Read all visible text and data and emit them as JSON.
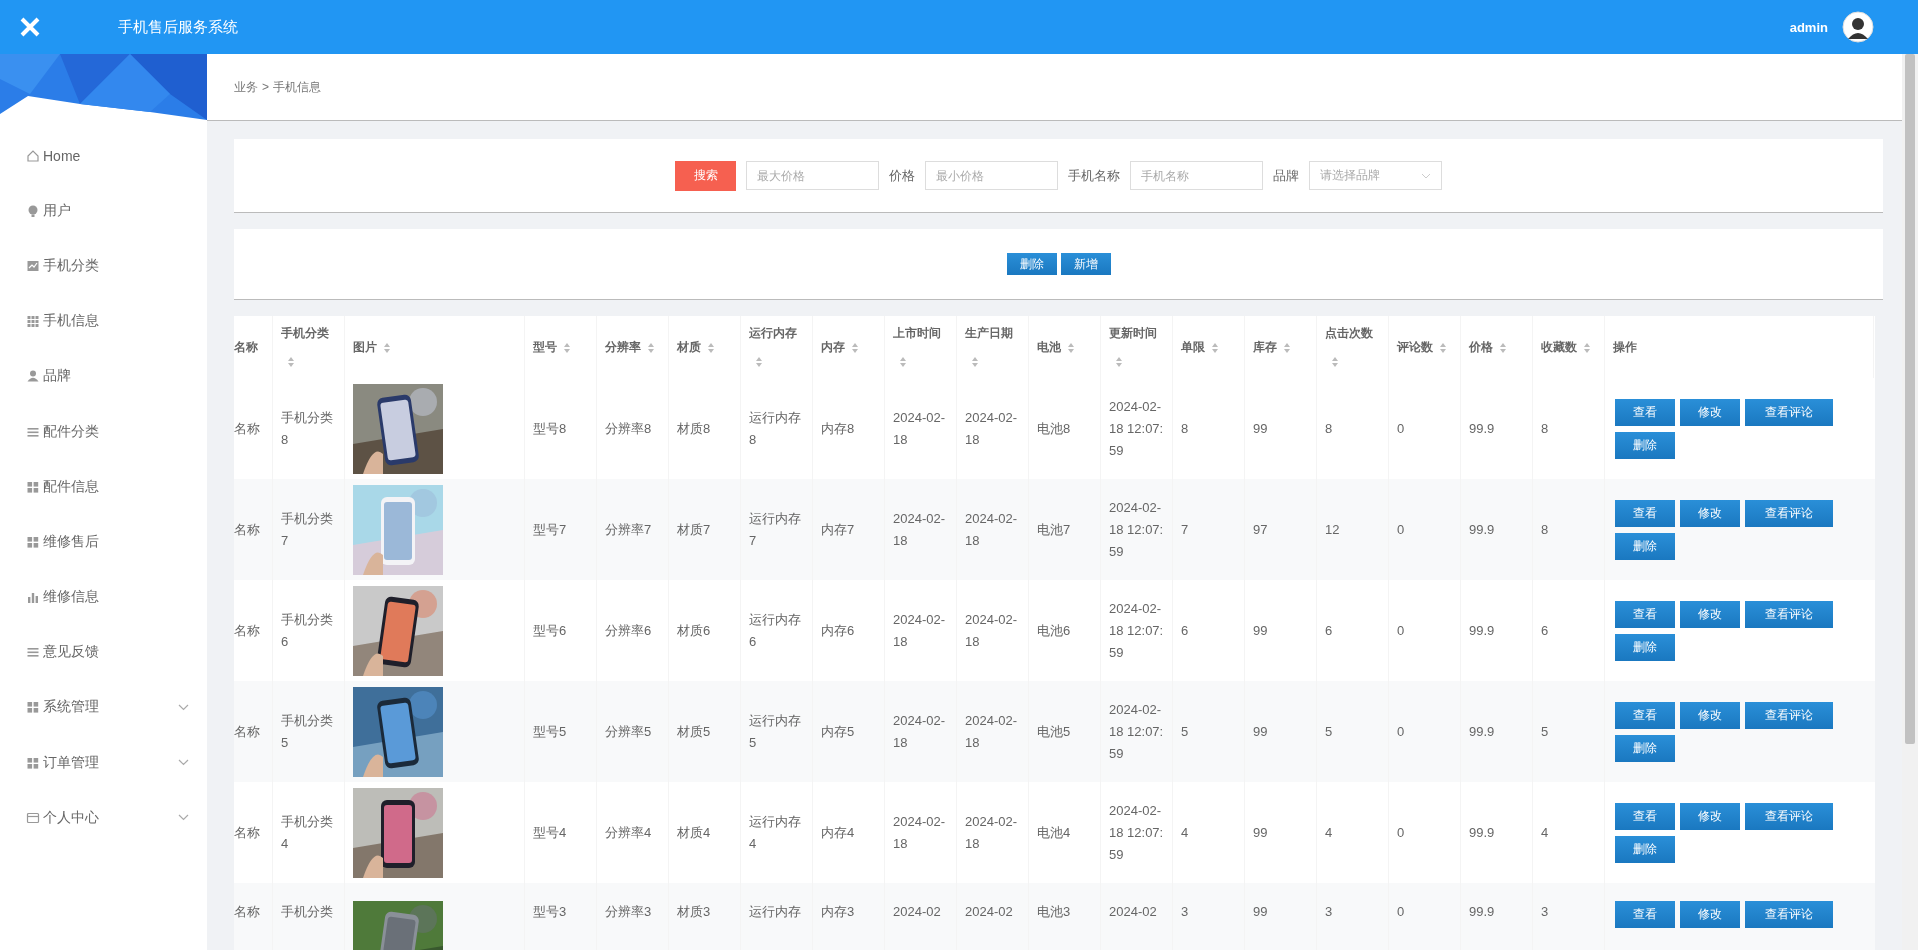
{
  "header": {
    "title": "手机售后服务系统",
    "user": "admin"
  },
  "sidebar": {
    "items": [
      {
        "label": "Home",
        "kind": "link"
      },
      {
        "label": "用户",
        "kind": "link"
      },
      {
        "label": "手机分类",
        "kind": "link"
      },
      {
        "label": "手机信息",
        "kind": "link"
      },
      {
        "label": "品牌",
        "kind": "link"
      },
      {
        "label": "配件分类",
        "kind": "link"
      },
      {
        "label": "配件信息",
        "kind": "link"
      },
      {
        "label": "维修售后",
        "kind": "link"
      },
      {
        "label": "维修信息",
        "kind": "link"
      },
      {
        "label": "意见反馈",
        "kind": "link"
      },
      {
        "label": "系统管理",
        "kind": "group"
      },
      {
        "label": "订单管理",
        "kind": "group"
      },
      {
        "label": "个人中心",
        "kind": "group"
      }
    ]
  },
  "breadcrumb": {
    "items": [
      "业务",
      "手机信息"
    ],
    "separator": ">"
  },
  "search": {
    "button": "搜索",
    "fields": [
      {
        "kind": "input",
        "placeholder": "最大价格"
      },
      {
        "kind": "input",
        "label": "价格",
        "placeholder": "最小价格"
      },
      {
        "kind": "input",
        "label": "手机名称",
        "placeholder": "手机名称"
      },
      {
        "kind": "select",
        "label": "品牌",
        "placeholder": "请选择品牌"
      }
    ]
  },
  "toolbar": {
    "buttons": [
      "删除",
      "新增"
    ]
  },
  "table": {
    "columns": [
      {
        "label": "名称",
        "sortable": false
      },
      {
        "label": "手机分类",
        "sortable": true
      },
      {
        "label": "图片",
        "sortable": true
      },
      {
        "label": "型号",
        "sortable": true
      },
      {
        "label": "分辨率",
        "sortable": true
      },
      {
        "label": "材质",
        "sortable": true
      },
      {
        "label": "运行内存",
        "sortable": true
      },
      {
        "label": "内存",
        "sortable": true
      },
      {
        "label": "上市时间",
        "sortable": true
      },
      {
        "label": "生产日期",
        "sortable": true
      },
      {
        "label": "电池",
        "sortable": true
      },
      {
        "label": "更新时间",
        "sortable": true
      },
      {
        "label": "单限",
        "sortable": true
      },
      {
        "label": "库存",
        "sortable": true
      },
      {
        "label": "点击次数",
        "sortable": true
      },
      {
        "label": "评论数",
        "sortable": true
      },
      {
        "label": "价格",
        "sortable": true
      },
      {
        "label": "收藏数",
        "sortable": true
      },
      {
        "label": "操作",
        "sortable": false
      }
    ],
    "rows": [
      {
        "cells": [
          "名称",
          "手机分类8",
          {
            "kind": "picture"
          },
          "型号8",
          "分辨率8",
          "材质8",
          "运行内存8",
          "内存8",
          "2024-02-18",
          "2024-02-18",
          "电池8",
          "2024-02-18 12:07:59",
          "8",
          "99",
          "8",
          "0",
          "99.9",
          "8"
        ],
        "actions": [
          "查看",
          "修改",
          "查看评论",
          "删除"
        ]
      },
      {
        "cells": [
          "名称",
          "手机分类7",
          {
            "kind": "picture"
          },
          "型号7",
          "分辨率7",
          "材质7",
          "运行内存7",
          "内存7",
          "2024-02-18",
          "2024-02-18",
          "电池7",
          "2024-02-18 12:07:59",
          "7",
          "97",
          "12",
          "0",
          "99.9",
          "8"
        ],
        "actions": [
          "查看",
          "修改",
          "查看评论",
          "删除"
        ]
      },
      {
        "cells": [
          "名称",
          "手机分类6",
          {
            "kind": "picture"
          },
          "型号6",
          "分辨率6",
          "材质6",
          "运行内存6",
          "内存6",
          "2024-02-18",
          "2024-02-18",
          "电池6",
          "2024-02-18 12:07:59",
          "6",
          "99",
          "6",
          "0",
          "99.9",
          "6"
        ],
        "actions": [
          "查看",
          "修改",
          "查看评论",
          "删除"
        ]
      },
      {
        "cells": [
          "名称",
          "手机分类5",
          {
            "kind": "picture"
          },
          "型号5",
          "分辨率5",
          "材质5",
          "运行内存5",
          "内存5",
          "2024-02-18",
          "2024-02-18",
          "电池5",
          "2024-02-18 12:07:59",
          "5",
          "99",
          "5",
          "0",
          "99.9",
          "5"
        ],
        "actions": [
          "查看",
          "修改",
          "查看评论",
          "删除"
        ]
      },
      {
        "cells": [
          "名称",
          "手机分类4",
          {
            "kind": "picture"
          },
          "型号4",
          "分辨率4",
          "材质4",
          "运行内存4",
          "内存4",
          "2024-02-18",
          "2024-02-18",
          "电池4",
          "2024-02-18 12:07:59",
          "4",
          "99",
          "4",
          "0",
          "99.9",
          "4"
        ],
        "actions": [
          "查看",
          "修改",
          "查看评论",
          "删除"
        ]
      },
      {
        "cells": [
          "名称",
          "手机分类",
          {
            "kind": "picture"
          },
          "型号3",
          "分辨率3",
          "材质3",
          "运行内存",
          "内存3",
          "2024-02",
          "2024-02",
          "电池3",
          "2024-02",
          "3",
          "99",
          "3",
          "0",
          "99.9",
          "3"
        ],
        "actions": [
          "查看",
          "修改",
          "查看评论"
        ]
      }
    ]
  }
}
